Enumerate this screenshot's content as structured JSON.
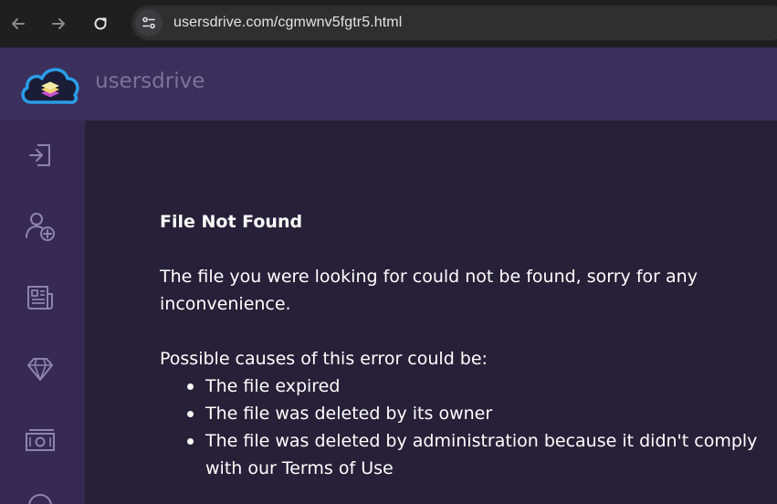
{
  "browser": {
    "url": "usersdrive.com/cgmwnv5fgtr5.html",
    "icons": [
      "back-arrow-icon",
      "forward-arrow-icon",
      "reload-icon",
      "site-info-icon"
    ]
  },
  "header": {
    "brand": "usersdrive",
    "logo_icon": "cloud-stack-logo-icon"
  },
  "sidebar": {
    "items": [
      {
        "icon": "login-icon"
      },
      {
        "icon": "add-user-icon"
      },
      {
        "icon": "newspaper-icon"
      },
      {
        "icon": "diamond-icon"
      },
      {
        "icon": "money-icon"
      },
      {
        "icon": "circle-icon"
      }
    ]
  },
  "main": {
    "title": "File Not Found",
    "description": "The file you were looking for could not be found, sorry for any inconvenience.",
    "causes_heading": "Possible causes of this error could be:",
    "causes": [
      "The file expired",
      "The file was deleted by its owner",
      "The file was deleted by administration because it didn't comply with our Terms of Use"
    ]
  },
  "colors": {
    "browser_bar": "#1f1f1f",
    "header_bg": "#3b2f5c",
    "sidebar_bg": "#362a54",
    "main_bg": "#262138",
    "brand_text": "#7c7396",
    "logo_cloud": "#2b9de8"
  }
}
